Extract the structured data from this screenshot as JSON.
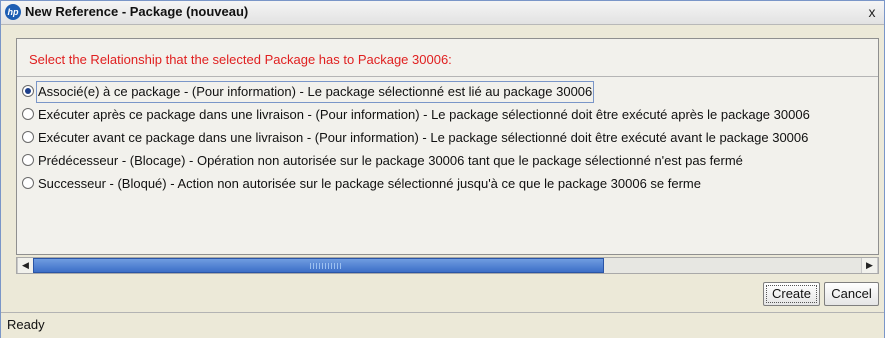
{
  "window": {
    "title": "New Reference - Package (nouveau)",
    "close_glyph": "x"
  },
  "panel": {
    "instruction": "Select the Relationship that the selected Package has to Package 30006:"
  },
  "options": [
    {
      "label": "Associé(e) à ce package - (Pour information) - Le package sélectionné est lié au package 30006",
      "selected": true
    },
    {
      "label": "Exécuter après ce package dans une livraison - (Pour information) - Le package sélectionné doit être exécuté après le package 30006",
      "selected": false
    },
    {
      "label": "Exécuter avant ce package dans une livraison - (Pour information) - Le package sélectionné doit être exécuté avant le package 30006",
      "selected": false
    },
    {
      "label": "Prédécesseur - (Blocage) - Opération non autorisée sur le package 30006 tant que le package sélectionné n'est pas fermé",
      "selected": false
    },
    {
      "label": "Successeur - (Bloqué) - Action non autorisée sur le package sélectionné jusqu'à ce que le package 30006 se ferme",
      "selected": false
    }
  ],
  "scrollbar": {
    "left_arrow": "◀",
    "right_arrow": "▶"
  },
  "buttons": {
    "create": "Create",
    "cancel": "Cancel"
  },
  "status": {
    "text": "Ready"
  },
  "colors": {
    "instruction": "#E02020",
    "scroll_thumb": "#3D6FC7",
    "title_icon": "#1E5EB3"
  }
}
